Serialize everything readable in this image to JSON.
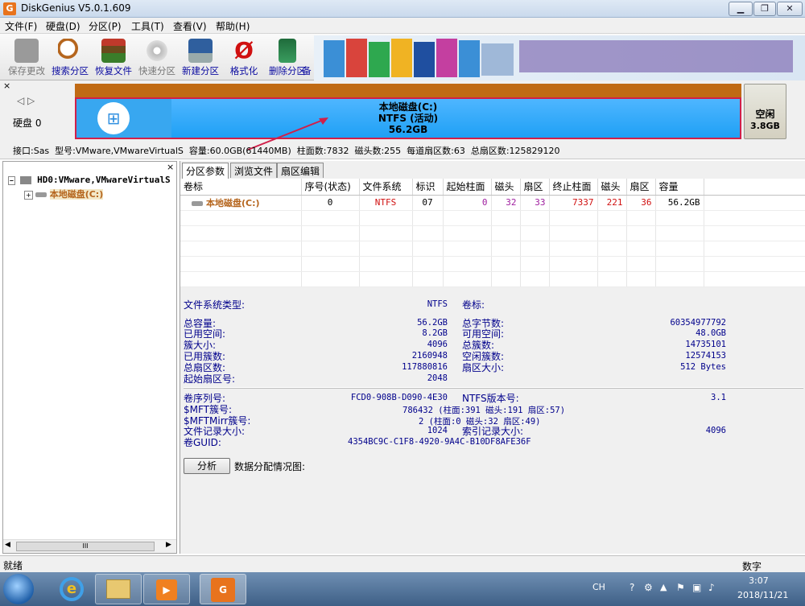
{
  "window": {
    "title": "DiskGenius V5.0.1.609",
    "app_icon": "G"
  },
  "menu": [
    "文件(F)",
    "硬盘(D)",
    "分区(P)",
    "工具(T)",
    "查看(V)",
    "帮助(H)"
  ],
  "toolbar": {
    "buttons": [
      {
        "label": "保存更改",
        "icon": "save-icon",
        "color": "#8a8a8a"
      },
      {
        "label": "搜索分区",
        "icon": "search-icon",
        "color": "#b5651d"
      },
      {
        "label": "恢复文件",
        "icon": "restore-icon",
        "color": "#3a7d2a"
      },
      {
        "label": "快速分区",
        "icon": "quick-partition-icon",
        "color": "#9a9a9a"
      },
      {
        "label": "新建分区",
        "icon": "new-partition-icon",
        "color": "#2f5f9e"
      },
      {
        "label": "格式化",
        "icon": "format-icon",
        "color": "#d01010"
      },
      {
        "label": "删除分区",
        "icon": "delete-icon",
        "color": "#2a7d4f"
      },
      {
        "label": "备",
        "icon": "backup-icon",
        "color": "#777"
      }
    ]
  },
  "disk_panel": {
    "disk_label": "硬盘 0",
    "partition": {
      "name": "本地磁盘(C:)",
      "fs": "NTFS (活动)",
      "size": "56.2GB"
    },
    "free": {
      "label": "空闲",
      "size": "3.8GB"
    },
    "info": "接口:Sas  型号:VMware,VMwareVirtualS  容量:60.0GB(61440MB)  柱面数:7832  磁头数:255  每道扇区数:63  总扇区数:125829120"
  },
  "tree": {
    "disk": "HD0:VMware,VMwareVirtualS",
    "partition": "本地磁盘(C:)"
  },
  "tabs": [
    "分区参数",
    "浏览文件",
    "扇区编辑"
  ],
  "table": {
    "headers": [
      "卷标",
      "序号(状态)",
      "文件系统",
      "标识",
      "起始柱面",
      "磁头",
      "扇区",
      "终止柱面",
      "磁头",
      "扇区",
      "容量"
    ],
    "row": [
      "本地磁盘(C:)",
      "0",
      "NTFS",
      "07",
      "0",
      "32",
      "33",
      "7337",
      "221",
      "36",
      "56.2GB"
    ]
  },
  "details": {
    "fs_type_label": "文件系统类型:",
    "fs_type": "NTFS",
    "volume_label_label": "卷标:",
    "left": [
      [
        "总容量:",
        "56.2GB"
      ],
      [
        "已用空间:",
        "8.2GB"
      ],
      [
        "簇大小:",
        "4096"
      ],
      [
        "已用簇数:",
        "2160948"
      ],
      [
        "总扇区数:",
        "117880816"
      ],
      [
        "起始扇区号:",
        "2048"
      ]
    ],
    "right": [
      [
        "总字节数:",
        "60354977792"
      ],
      [
        "可用空间:",
        "48.0GB"
      ],
      [
        "总簇数:",
        "14735101"
      ],
      [
        "空闲簇数:",
        "12574153"
      ],
      [
        "扇区大小:",
        "512 Bytes"
      ]
    ],
    "serial": [
      [
        "卷序列号:",
        "FCD0-908B-D090-4E30"
      ],
      [
        "$MFT簇号:",
        "786432 (柱面:391 磁头:191 扇区:57)"
      ],
      [
        "$MFTMirr簇号:",
        "2 (柱面:0 磁头:32 扇区:49)"
      ],
      [
        "文件记录大小:",
        "1024"
      ],
      [
        "卷GUID:",
        "4354BC9C-C1F8-4920-9A4C-B10DF8AFE36F"
      ]
    ],
    "ntfs": [
      [
        "NTFS版本号:",
        "3.1"
      ],
      [
        "索引记录大小:",
        "4096"
      ]
    ],
    "analyze_button": "分析",
    "distribution_label": "数据分配情况图:"
  },
  "status": {
    "text": "就绪",
    "mode": "数字"
  },
  "taskbar": {
    "lang": "CH",
    "time": "3:07",
    "date": "2018/11/21"
  }
}
